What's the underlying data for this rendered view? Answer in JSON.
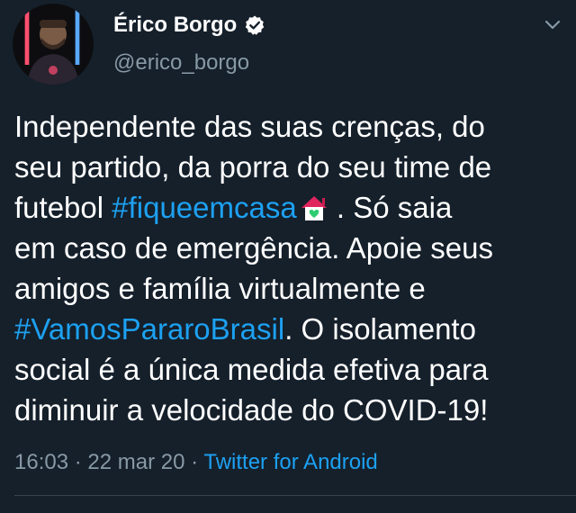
{
  "user": {
    "display_name": "Érico Borgo",
    "handle": "@erico_borgo"
  },
  "tweet": {
    "segments": {
      "s1": "Independente das suas crenças, do",
      "s2": "seu partido, da porra do seu time de",
      "s3": "futebol ",
      "hashtag1": "#fiqueemcasa",
      "s4": " . Só saia",
      "s5": "em caso de emergência. Apoie seus",
      "s6": "amigos e família virtualmente e",
      "hashtag2": "#VamosPararoBrasil",
      "s7": ". O isolamento",
      "s8": "social é a única medida efetiva para",
      "s9": "diminuir a velocidade do COVID-19!"
    }
  },
  "meta": {
    "time": "16:03",
    "sep1": " · ",
    "date": "22 mar 20",
    "sep2": " · ",
    "source": "Twitter for Android"
  },
  "icons": {
    "verified": "verified-badge-icon",
    "caret": "chevron-down-icon",
    "emoji": "house-with-heart-emoji"
  },
  "colors": {
    "background": "#15202b",
    "link": "#1da1f2",
    "secondary_text": "#8899a6"
  }
}
